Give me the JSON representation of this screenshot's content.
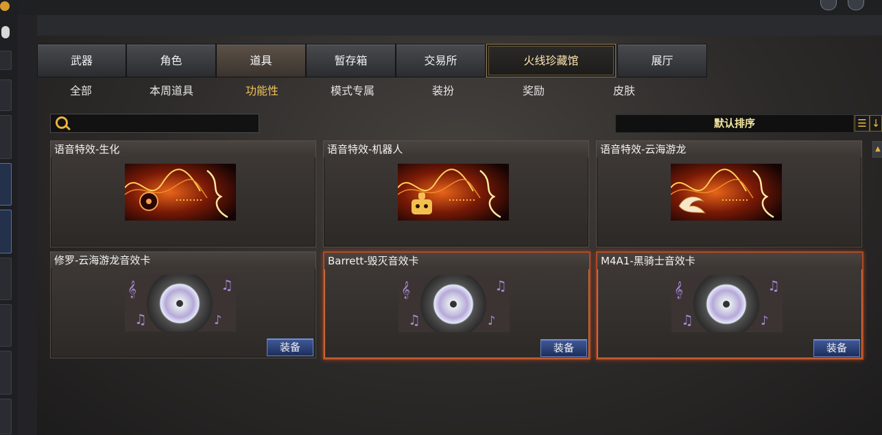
{
  "tabs": [
    {
      "label": "武器"
    },
    {
      "label": "角色"
    },
    {
      "label": "道具"
    },
    {
      "label": "暂存箱"
    },
    {
      "label": "交易所"
    },
    {
      "label": "火线珍藏馆"
    },
    {
      "label": "展厅"
    }
  ],
  "active_tab": "道具",
  "subtabs": [
    {
      "label": "全部"
    },
    {
      "label": "本周道具"
    },
    {
      "label": "功能性"
    },
    {
      "label": "模式专属"
    },
    {
      "label": "装扮"
    },
    {
      "label": "奖励"
    },
    {
      "label": "皮肤"
    }
  ],
  "active_subtab": "功能性",
  "search": {
    "placeholder": "",
    "value": ""
  },
  "sort": {
    "label": "默认排序"
  },
  "items": [
    {
      "title": "语音特效-生化",
      "kind": "voice",
      "badge_icon": "biohazard-icon"
    },
    {
      "title": "语音特效-机器人",
      "kind": "voice",
      "badge_icon": "robot-icon"
    },
    {
      "title": "语音特效-云海游龙",
      "kind": "voice",
      "badge_icon": "dragon-icon"
    },
    {
      "title": "修罗-云海游龙音效卡",
      "kind": "sound-card",
      "button": "装备"
    },
    {
      "title": "Barrett-毁灭音效卡",
      "kind": "sound-card",
      "button": "装备"
    },
    {
      "title": "M4A1-黑骑士音效卡",
      "kind": "sound-card",
      "button": "装备"
    }
  ],
  "colors": {
    "accent": "#f3c45a",
    "selected_border": "#b04a28",
    "equip_button": "#2e4580"
  }
}
